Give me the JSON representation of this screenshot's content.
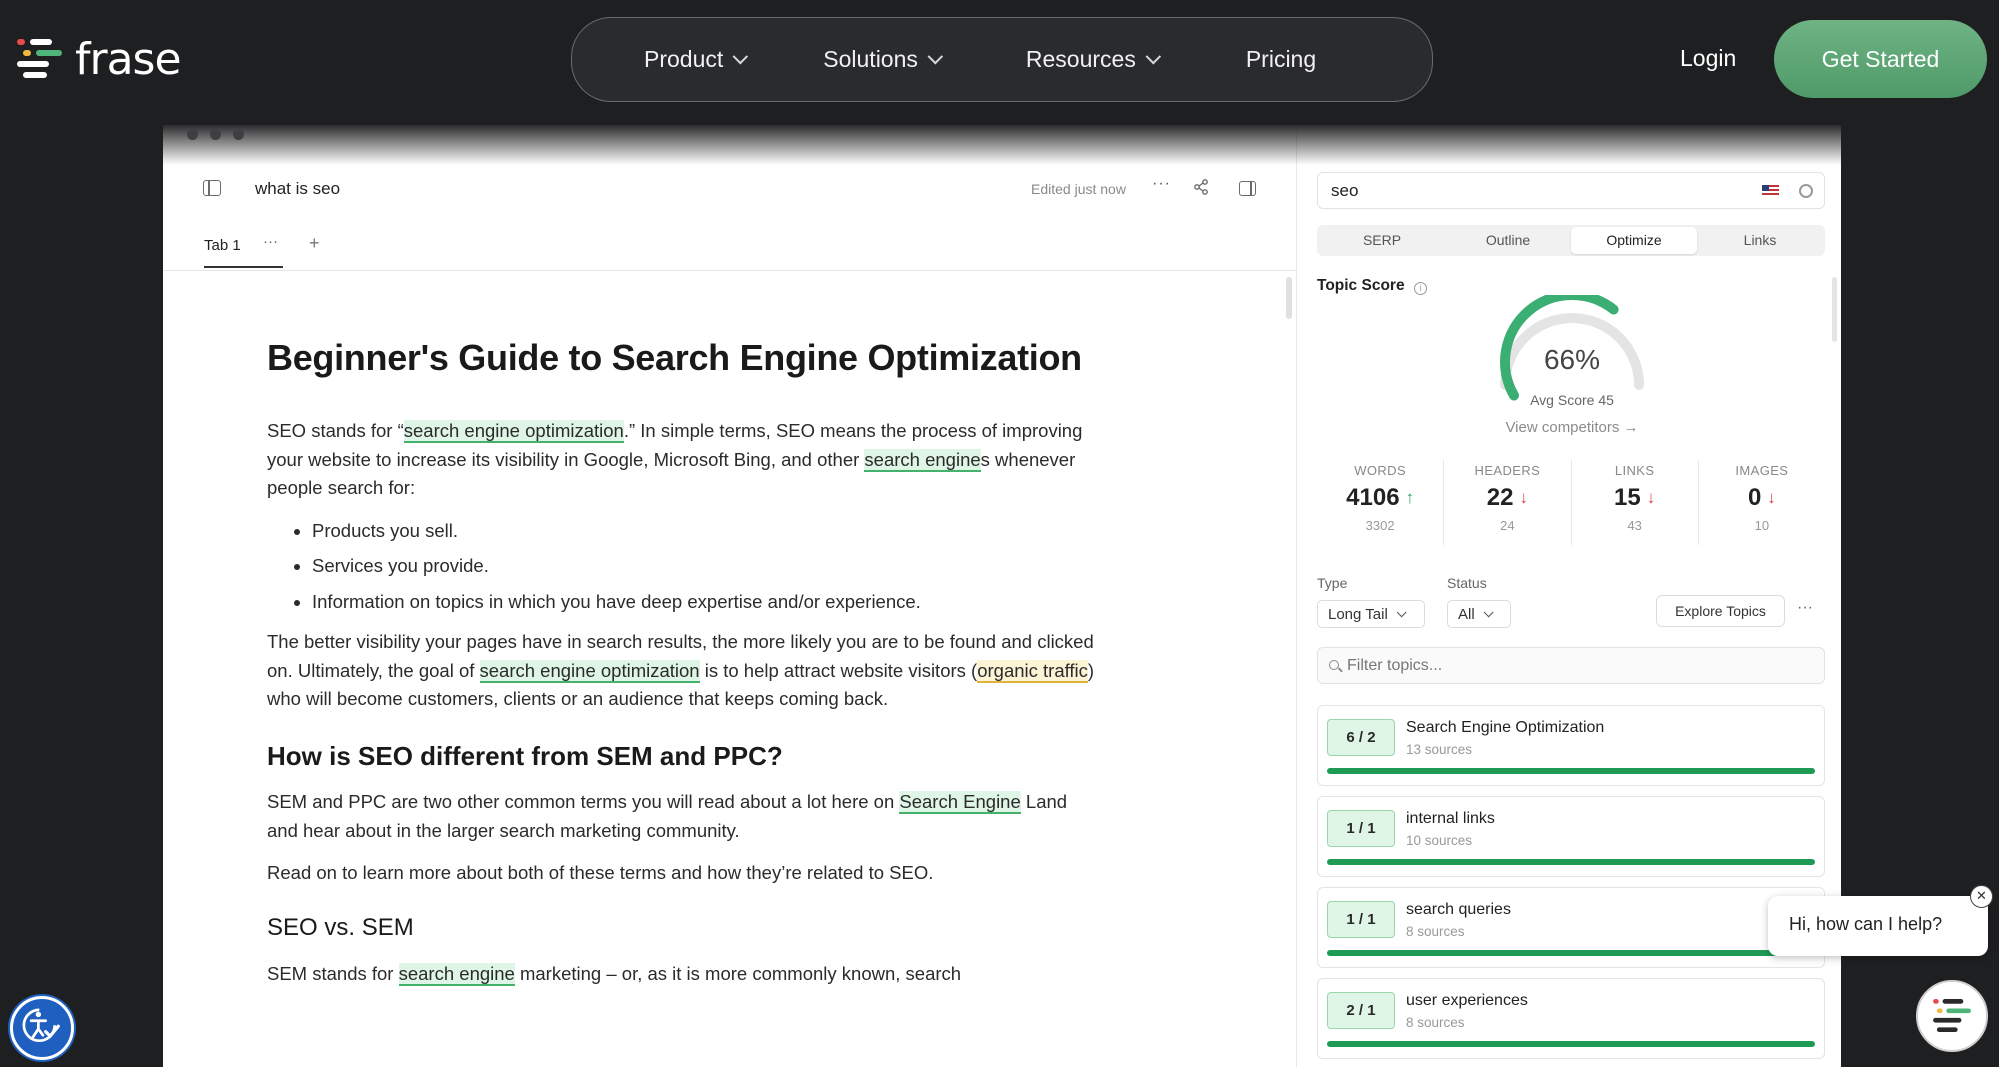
{
  "brand": {
    "name": "frase"
  },
  "nav": {
    "items": [
      {
        "label": "Product",
        "has_dropdown": true
      },
      {
        "label": "Solutions",
        "has_dropdown": true
      },
      {
        "label": "Resources",
        "has_dropdown": true
      },
      {
        "label": "Pricing",
        "has_dropdown": false
      }
    ],
    "login": "Login",
    "cta": "Get Started"
  },
  "editor": {
    "doc_title": "what is seo",
    "edited": "Edited just now",
    "tab": "Tab 1",
    "more": "···",
    "add_tab": "+",
    "content": {
      "h1": "Beginner's Guide to Search Engine Optimization",
      "p1": {
        "a": "SEO stands for “",
        "hl1": "search engine optimization",
        "b": ".” In simple terms, SEO means the process of improving your website to increase its visibility in Google, Microsoft Bing, and other ",
        "hl2": "search engine",
        "c": "s whenever people search for:"
      },
      "bullets": [
        "Products you sell.",
        "Services you provide.",
        "Information on topics in which you have deep expertise and/or experience."
      ],
      "p2": {
        "a": "The better visibility your pages have in search results, the more likely you are to be found and clicked on. Ultimately, the goal of ",
        "hl1": "search engine optimization",
        "b": " is to help attract website visitors (",
        "hl2": "organic traffic",
        "c": ") who will become customers, clients or an audience that keeps coming back."
      },
      "h2": "How is SEO different from SEM and PPC?",
      "p3": {
        "a": "SEM and PPC are two other common terms you will read about a lot here on ",
        "hl1": "Search Engine",
        "b": " Land and hear about in the larger search marketing community."
      },
      "p4": "Read on to learn more about both of these terms and how they’re related to SEO.",
      "h3": "SEO vs. SEM",
      "p5": {
        "a": "SEM stands for ",
        "hl1": "search engine",
        "b": " marketing – or, as it is more commonly known, search"
      }
    }
  },
  "panel": {
    "keyword": "seo",
    "tabs": [
      "SERP",
      "Outline",
      "Optimize",
      "Links"
    ],
    "active_tab": "Optimize",
    "topic_score": {
      "label": "Topic Score",
      "info": "i",
      "value": 66,
      "value_text": "66%",
      "avg_text": "Avg Score 45",
      "competitors_link": "View competitors →"
    },
    "stats": [
      {
        "label": "WORDS",
        "value": "4106",
        "trend": "↑",
        "trend_dir": "up",
        "target": "3302"
      },
      {
        "label": "HEADERS",
        "value": "22",
        "trend": "↓",
        "trend_dir": "down",
        "target": "24"
      },
      {
        "label": "LINKS",
        "value": "15",
        "trend": "↓",
        "trend_dir": "down",
        "target": "43"
      },
      {
        "label": "IMAGES",
        "value": "0",
        "trend": "↓",
        "trend_dir": "down",
        "target": "10"
      }
    ],
    "filters": {
      "type_label": "Type",
      "type_value": "Long Tail",
      "status_label": "Status",
      "status_value": "All",
      "explore": "Explore Topics",
      "more": "···",
      "search_placeholder": "Filter topics..."
    },
    "topics": [
      {
        "badge": "6 / 2",
        "name": "Search Engine Optimization",
        "sources": "13 sources",
        "progress": 1.0
      },
      {
        "badge": "1 / 1",
        "name": "internal links",
        "sources": "10 sources",
        "progress": 1.0
      },
      {
        "badge": "1 / 1",
        "name": "search queries",
        "sources": "8 sources",
        "progress": 1.0
      },
      {
        "badge": "2 / 1",
        "name": "user experiences",
        "sources": "8 sources",
        "progress": 1.0
      }
    ]
  },
  "chat": {
    "message": "Hi, how can I help?",
    "close": "✕"
  },
  "colors": {
    "accent_green": "#4f9a69",
    "highlight_green": "#43b26a",
    "highlight_yellow": "#e3b23c",
    "trend_up": "#2fa35d",
    "trend_down": "#d84848"
  }
}
